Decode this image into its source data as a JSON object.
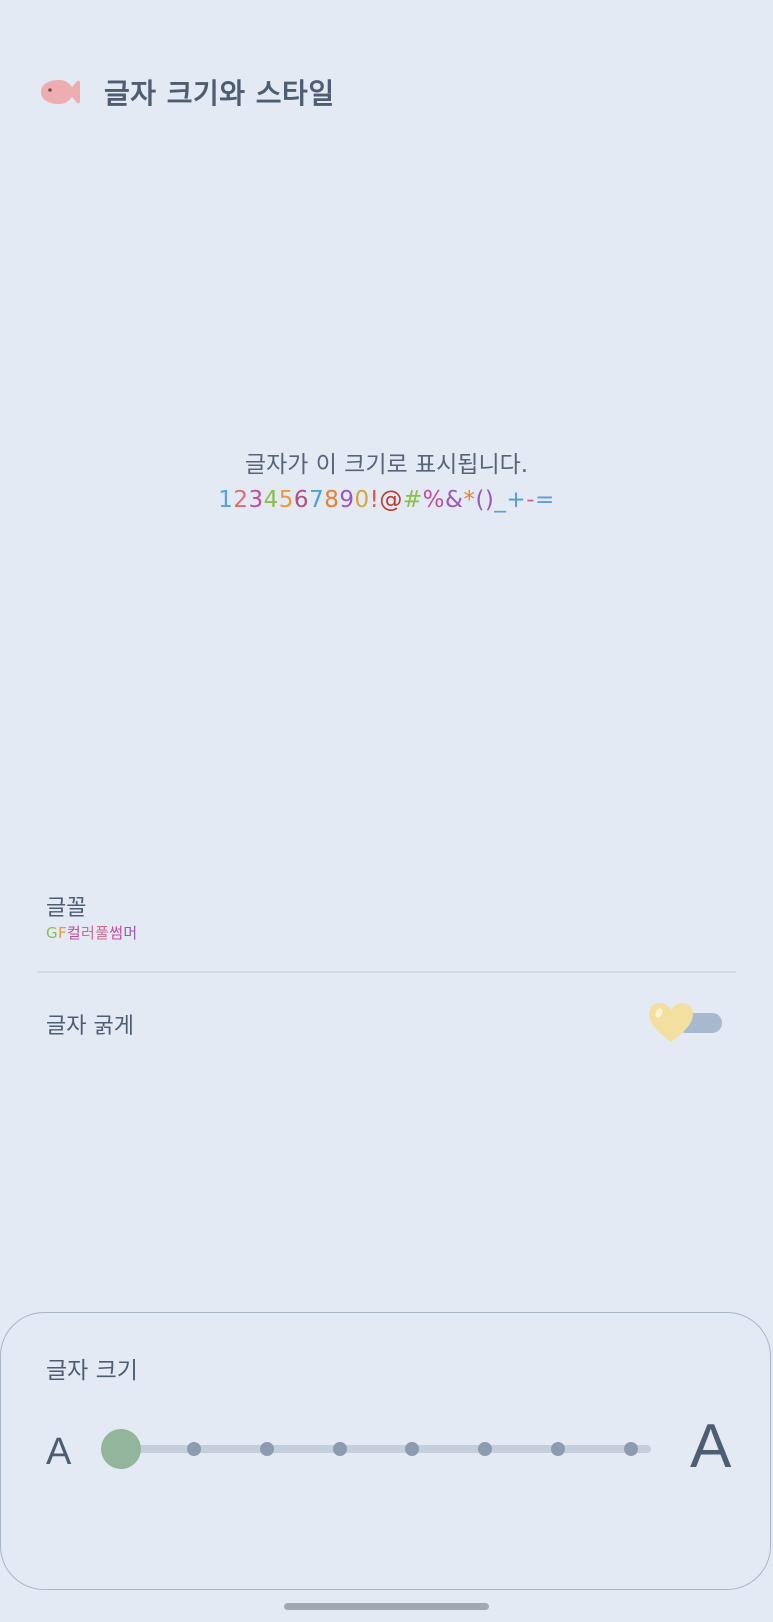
{
  "header": {
    "title": "글자 크기와 스타일",
    "back_icon": "fish-back-icon",
    "back_icon_color": "#eeaeb1"
  },
  "preview": {
    "text": "글자가 이 크기로 표시됩니다.",
    "chars": [
      {
        "ch": "1",
        "color": "#5a9fd6"
      },
      {
        "ch": "2",
        "color": "#e06c6c"
      },
      {
        "ch": "3",
        "color": "#c04f9a"
      },
      {
        "ch": "4",
        "color": "#8bbf4a"
      },
      {
        "ch": "5",
        "color": "#e89a3c"
      },
      {
        "ch": "6",
        "color": "#b0507f"
      },
      {
        "ch": "7",
        "color": "#4f9fd6"
      },
      {
        "ch": "8",
        "color": "#e0833a"
      },
      {
        "ch": "9",
        "color": "#9b59b6"
      },
      {
        "ch": "0",
        "color": "#d8a53a"
      },
      {
        "ch": "!",
        "color": "#d9534f"
      },
      {
        "ch": "@",
        "color": "#c0392b"
      },
      {
        "ch": "#",
        "color": "#8bbf4a"
      },
      {
        "ch": "%",
        "color": "#c04f9a"
      },
      {
        "ch": "&",
        "color": "#9b59b6"
      },
      {
        "ch": "*",
        "color": "#e0833a"
      },
      {
        "ch": "(",
        "color": "#9b59b6"
      },
      {
        "ch": ")",
        "color": "#9b59b6"
      },
      {
        "ch": "_",
        "color": "#5a9fd6"
      },
      {
        "ch": "+",
        "color": "#4f9fd6"
      },
      {
        "ch": "-",
        "color": "#d06a8a"
      },
      {
        "ch": "=",
        "color": "#5a9fd6"
      }
    ]
  },
  "font_setting": {
    "label": "글꼴",
    "value_chars": [
      {
        "ch": "G",
        "color": "#8bbf4a"
      },
      {
        "ch": "F",
        "color": "#e89a3c"
      },
      {
        "ch": "컬",
        "color": "#c04f9a"
      },
      {
        "ch": "러",
        "color": "#d06a8a"
      },
      {
        "ch": "풀",
        "color": "#d06a8a"
      },
      {
        "ch": "썸",
        "color": "#c04f9a"
      },
      {
        "ch": "머",
        "color": "#9b59b6"
      }
    ]
  },
  "bold_setting": {
    "label": "글자 굵게",
    "enabled": false,
    "thumb_icon": "heart-icon",
    "thumb_color": "#f3dfa0",
    "track_color": "#a7b9cf"
  },
  "size_panel": {
    "label": "글자 크기",
    "small_glyph": "A",
    "large_glyph": "A",
    "steps": 8,
    "selected_step": 0,
    "thumb_color": "#92b59c"
  }
}
